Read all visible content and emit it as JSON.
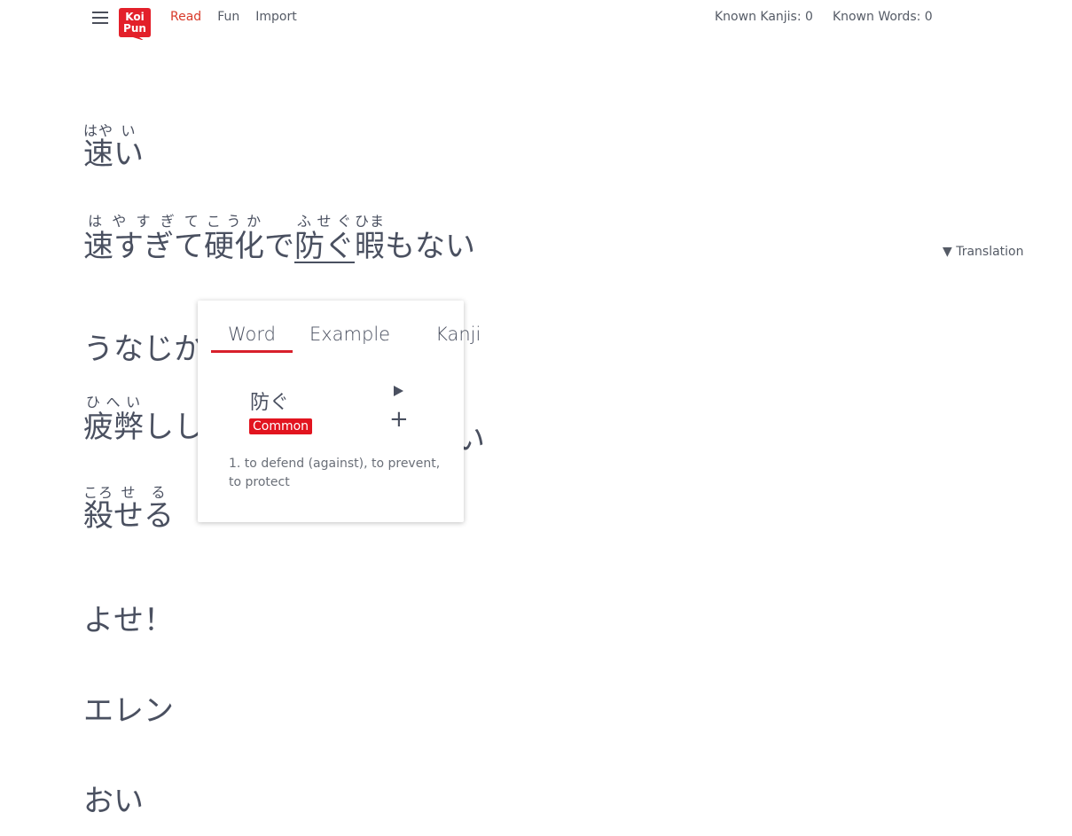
{
  "header": {
    "logo_alt": "KoiPun",
    "nav": [
      {
        "label": "Read",
        "active": true
      },
      {
        "label": "Fun",
        "active": false
      },
      {
        "label": "Import",
        "active": false
      }
    ],
    "known_kanjis": "Known Kanjis: 0",
    "known_words": "Known Words: 0",
    "accent_color": "#d83a2a"
  },
  "reading": {
    "lines": [
      {
        "segments": [
          {
            "text": "速",
            "ruby": "はや"
          },
          {
            "text": "い",
            "ruby": "い"
          }
        ]
      },
      {
        "segments": [
          {
            "text": "速すぎて",
            "ruby": "はやすぎて"
          },
          {
            "text": "硬化",
            "ruby": "こうか"
          },
          {
            "text": "で",
            "ruby": ""
          },
          {
            "text": "防ぐ",
            "ruby": "ふせぐ"
          },
          {
            "text": "暇",
            "ruby": "ひま"
          },
          {
            "text": "もない",
            "ruby": ""
          }
        ]
      },
      {
        "segments": [
          {
            "text": "うなじか",
            "ruby": ""
          }
        ]
      },
      {
        "segments": [
          {
            "text": "疲弊",
            "ruby": "ひへい"
          },
          {
            "text": "しし",
            "ruby": ""
          }
        ],
        "tail": "い"
      },
      {
        "segments": [
          {
            "text": "殺",
            "ruby": "ころ"
          },
          {
            "text": "せる",
            "ruby": "せる"
          }
        ]
      },
      {
        "segments": [
          {
            "text": "よせ！",
            "ruby": ""
          }
        ]
      },
      {
        "segments": [
          {
            "text": "エレン",
            "ruby": ""
          }
        ]
      },
      {
        "segments": [
          {
            "text": "おい",
            "ruby": ""
          }
        ]
      }
    ],
    "translation_toggle": "▼ Translation"
  },
  "popup": {
    "tabs": [
      "Word",
      "Example",
      "Kanji"
    ],
    "active_tab": "Word",
    "word": "防ぐ",
    "badge": "Common",
    "badge_color": "#e2141f",
    "definition": "1.  to defend (against), to prevent, to protect",
    "play_icon": "play-icon",
    "add_icon": "plus-icon"
  }
}
